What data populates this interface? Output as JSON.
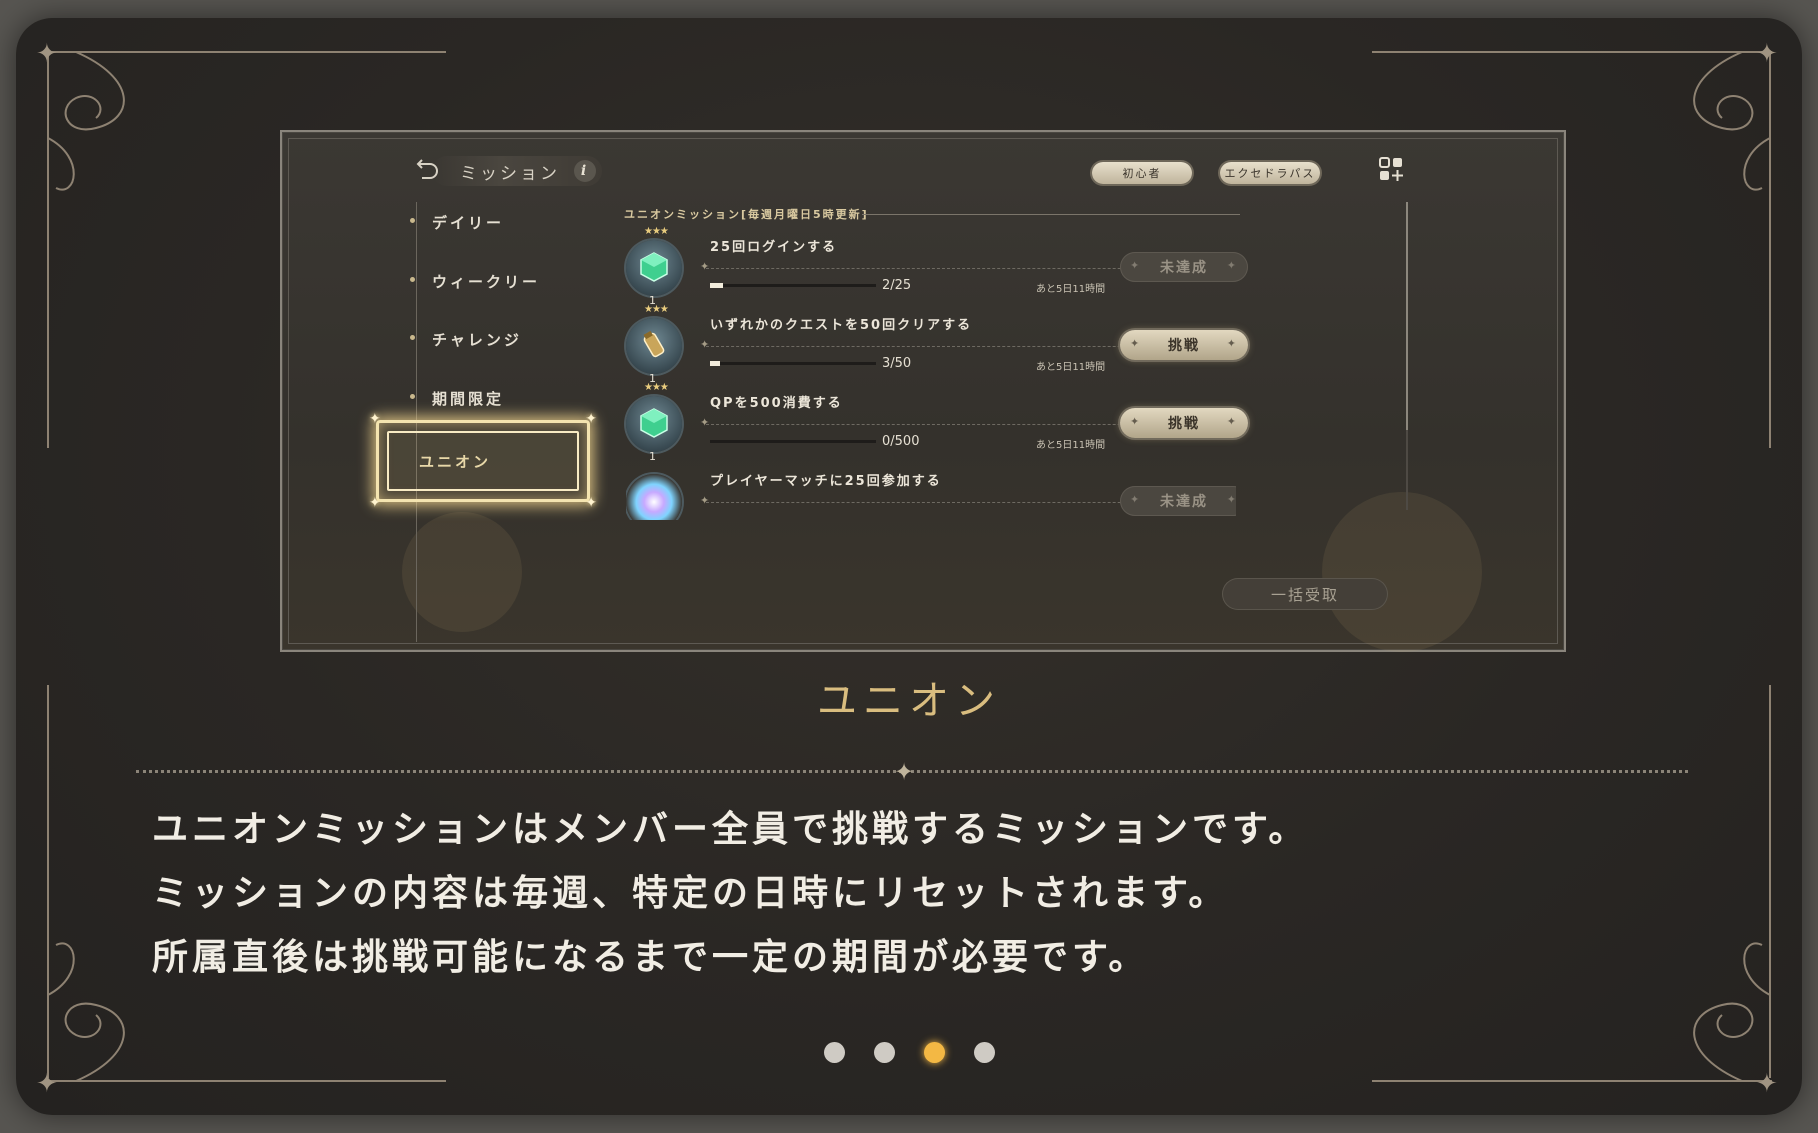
{
  "screenshot": {
    "nav": {
      "title": "ミッション",
      "info_label": "i",
      "items": [
        {
          "label": "デイリー"
        },
        {
          "label": "ウィークリー"
        },
        {
          "label": "チャレンジ"
        },
        {
          "label": "期間限定"
        },
        {
          "label": "ユニオン",
          "selected": true
        }
      ]
    },
    "top_buttons": {
      "beginner": "初心者",
      "express": "エクセドラパス"
    },
    "section_header": "ユニオンミッション[毎週月曜日5時更新]",
    "missions": [
      {
        "title": "25回ログインする",
        "progress": "2/25",
        "progress_value": 0.08,
        "remaining": "あと5日11時間",
        "button": "未達成",
        "button_state": "disabled",
        "reward_count": "1",
        "reward_icon": "green-gem-icon"
      },
      {
        "title": "いずれかのクエストを50回クリアする",
        "progress": "3/50",
        "progress_value": 0.06,
        "remaining": "あと5日11時間",
        "button": "挑戦",
        "button_state": "active",
        "reward_count": "1",
        "reward_icon": "potion-icon"
      },
      {
        "title": "QPを500消費する",
        "progress": "0/500",
        "progress_value": 0.0,
        "remaining": "あと5日11時間",
        "button": "挑戦",
        "button_state": "active",
        "reward_count": "1",
        "reward_icon": "green-gem-icon"
      },
      {
        "title": "プレイヤーマッチに25回参加する",
        "button": "未達成",
        "button_state": "disabled",
        "reward_icon": "rainbow-orb-icon"
      }
    ],
    "bulk_button": "一括受取"
  },
  "caption": {
    "title": "ユニオン",
    "lines": [
      "ユニオンミッションはメンバー全員で挑戦するミッションです。",
      "ミッションの内容は毎週、特定の日時にリセットされます。",
      "所属直後は挑戦可能になるまで一定の期間が必要です。"
    ]
  },
  "pager": {
    "total": 4,
    "active_index": 2
  },
  "colors": {
    "gold": "#d9bd7f",
    "pager_active": "#f3b844",
    "panel_bg": "#2a2724"
  }
}
